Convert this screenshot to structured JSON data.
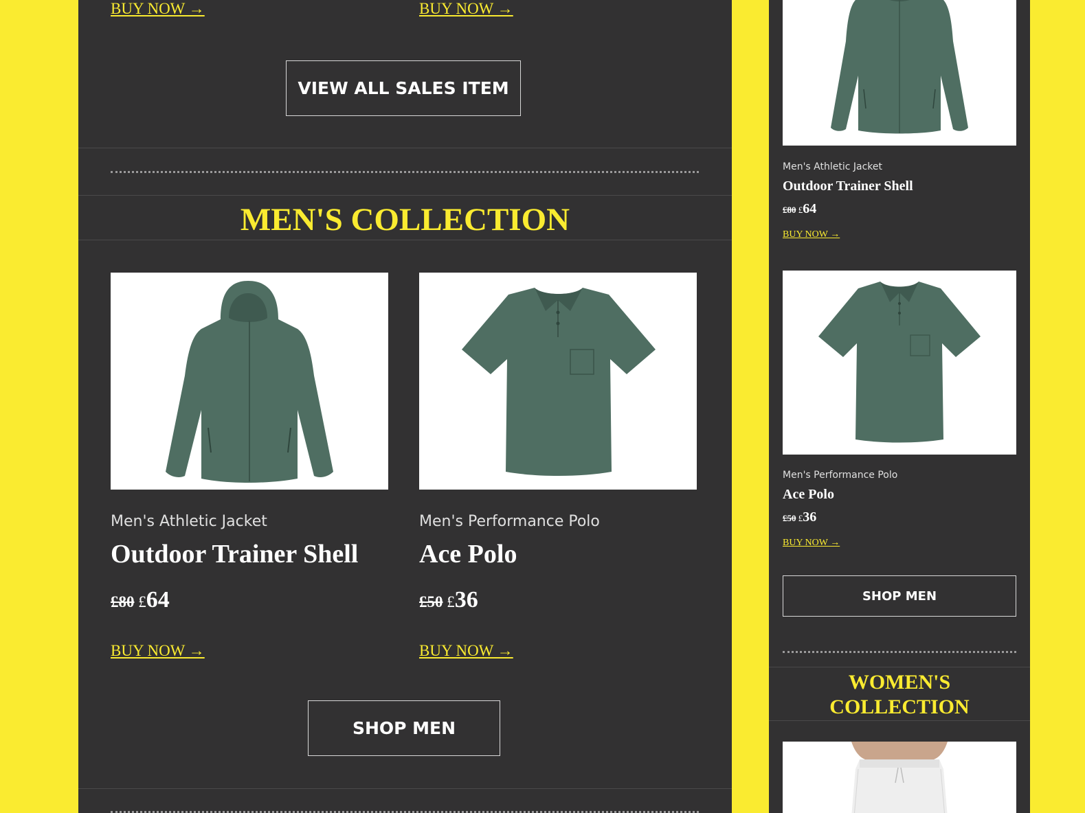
{
  "colors": {
    "accent": "#faeb30",
    "panel": "#323132",
    "garment": "#4f6e62"
  },
  "sales": {
    "buy_now_labels": [
      "BUY NOW →",
      "BUY NOW →"
    ],
    "view_all_label": "VIEW ALL SALES ITEM"
  },
  "mens": {
    "title": "MEN'S COLLECTION",
    "products": [
      {
        "category": "Men's Athletic Jacket",
        "name": "Outdoor Trainer Shell",
        "old_price": "£80",
        "currency": "£",
        "price": "64",
        "buy_label": "BUY NOW →",
        "image_icon": "jacket-icon"
      },
      {
        "category": "Men's Performance Polo",
        "name": "Ace Polo",
        "old_price": "£50",
        "currency": "£",
        "price": "36",
        "buy_label": "BUY NOW →",
        "image_icon": "polo-shirt-icon"
      }
    ],
    "shop_label": "SHOP MEN"
  },
  "mobile": {
    "products": [
      {
        "category": "Men's Athletic Jacket",
        "name": "Outdoor Trainer Shell",
        "old_price": "£80",
        "currency": "£",
        "price": "64",
        "buy_label": "BUY NOW →"
      },
      {
        "category": "Men's Performance Polo",
        "name": "Ace Polo",
        "old_price": "£50",
        "currency": "£",
        "price": "36",
        "buy_label": "BUY NOW →"
      }
    ],
    "shop_label": "SHOP MEN",
    "womens_title_line1": "WOMEN'S",
    "womens_title_line2": "COLLECTION",
    "womens_image_icon": "white-shorts-icon"
  }
}
